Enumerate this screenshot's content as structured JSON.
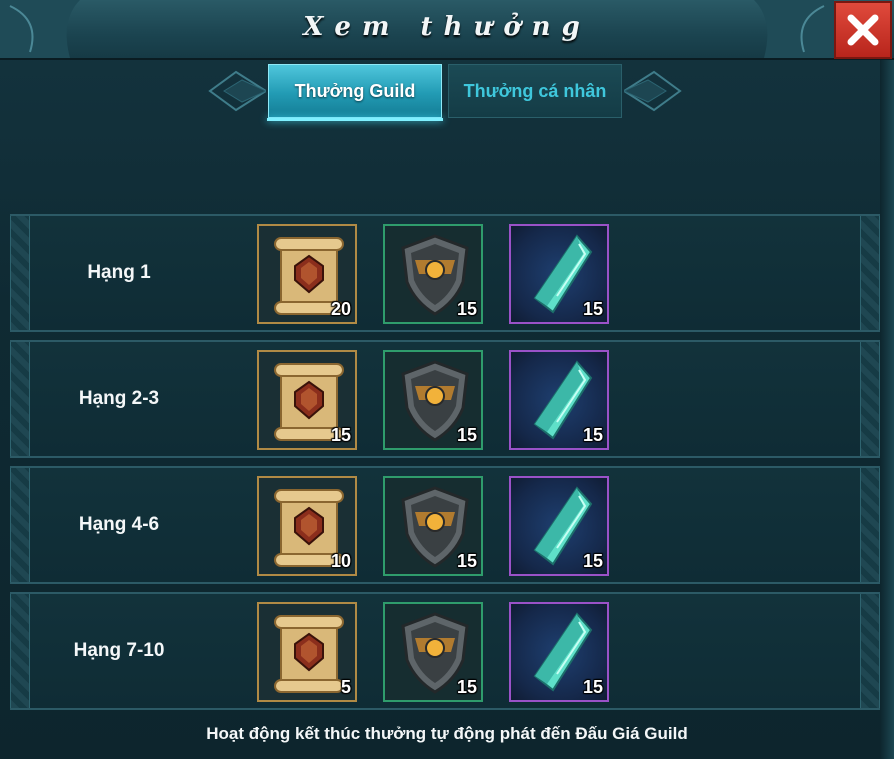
{
  "window": {
    "title": "Xem thưởng",
    "close_icon": "close-icon"
  },
  "tabs": [
    {
      "label": "Thưởng Guild",
      "active": true
    },
    {
      "label": "Thưởng cá nhân",
      "active": false
    }
  ],
  "rows": [
    {
      "rank": "Hạng 1",
      "items": [
        {
          "icon": "scroll-icon",
          "qty": "20"
        },
        {
          "icon": "shield-icon",
          "qty": "15"
        },
        {
          "icon": "crystal-icon",
          "qty": "15"
        }
      ]
    },
    {
      "rank": "Hạng 2-3",
      "items": [
        {
          "icon": "scroll-icon",
          "qty": "15"
        },
        {
          "icon": "shield-icon",
          "qty": "15"
        },
        {
          "icon": "crystal-icon",
          "qty": "15"
        }
      ]
    },
    {
      "rank": "Hạng 4-6",
      "items": [
        {
          "icon": "scroll-icon",
          "qty": "10"
        },
        {
          "icon": "shield-icon",
          "qty": "15"
        },
        {
          "icon": "crystal-icon",
          "qty": "15"
        }
      ]
    },
    {
      "rank": "Hạng 7-10",
      "items": [
        {
          "icon": "scroll-icon",
          "qty": "5"
        },
        {
          "icon": "shield-icon",
          "qty": "15"
        },
        {
          "icon": "crystal-icon",
          "qty": "15"
        }
      ]
    }
  ],
  "footer": "Hoạt động kết thúc thưởng tự động phát đến Đấu Giá Guild",
  "colors": {
    "accent_tab": "#229bb4",
    "close_red": "#d0362a",
    "scroll_border": "#b08a45",
    "shield_border": "#2f9c6c",
    "crystal_border": "#9a52c8"
  }
}
